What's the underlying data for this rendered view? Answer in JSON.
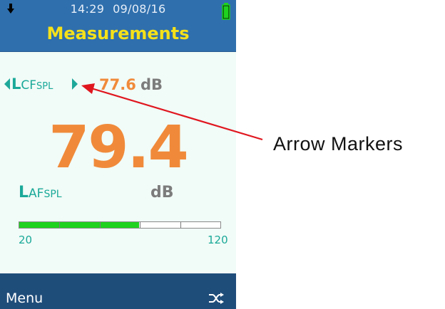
{
  "status": {
    "time": "14:29",
    "date": "09/08/16"
  },
  "header": {
    "title": "Measurements"
  },
  "secondary": {
    "label_main": "L",
    "label_weight": "CF",
    "label_sub": "SPL",
    "value": "77.6",
    "unit": "dB"
  },
  "primary": {
    "value": "79.4",
    "label_main": "L",
    "label_weight": "AF",
    "label_sub": "SPL",
    "unit": "dB"
  },
  "level_bar": {
    "min_label": "20",
    "max_label": "120",
    "min": 20,
    "max": 120,
    "level": 79.4,
    "fill_color": "#1fd21f"
  },
  "footer": {
    "menu_label": "Menu",
    "icon": "shuffle-icon"
  },
  "annotation": {
    "text": "Arrow Markers",
    "color": "#e0161f"
  },
  "colors": {
    "header_bg": "#2f6fad",
    "title": "#f5e11a",
    "value_orange": "#f08a3a",
    "label_teal": "#1aa999",
    "footer_bg": "#1f4d7a"
  }
}
